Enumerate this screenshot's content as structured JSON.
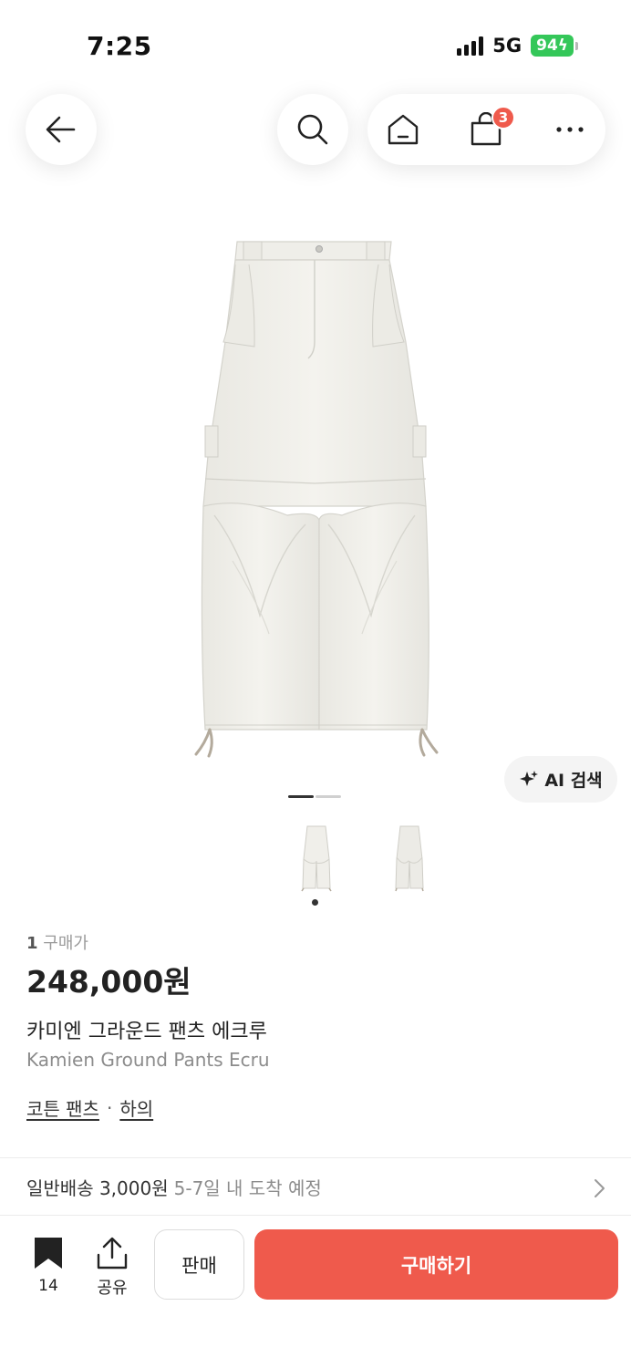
{
  "status_bar": {
    "time": "7:25",
    "network": "5G",
    "battery": "94"
  },
  "nav": {
    "back_icon": "arrow-left-icon",
    "search_icon": "search-icon",
    "home_icon": "home-icon",
    "cart_icon": "shopping-bag-icon",
    "cart_badge": "3",
    "more_icon": "more-horizontal-icon"
  },
  "gallery": {
    "ai_search_label": "AI 검색",
    "ai_icon": "sparkle-icon",
    "page_count": 2,
    "active_page": 1
  },
  "product": {
    "purchase_count": "1",
    "purchase_label": "구매가",
    "price": "248,000원",
    "name_ko": "카미엔 그라운드 팬츠 에크루",
    "name_en": "Kamien Ground Pants Ecru",
    "tags": [
      "코튼 팬츠",
      "하의"
    ],
    "tag_separator": "·"
  },
  "shipping": {
    "main": "일반배송 3,000원",
    "sub": "5-7일 내 도착 예정"
  },
  "bottom_bar": {
    "bookmark_count": "14",
    "share_label": "공유",
    "sell_label": "판매",
    "buy_label": "구매하기"
  },
  "colors": {
    "accent": "#ef5a4c",
    "battery": "#34c759"
  }
}
